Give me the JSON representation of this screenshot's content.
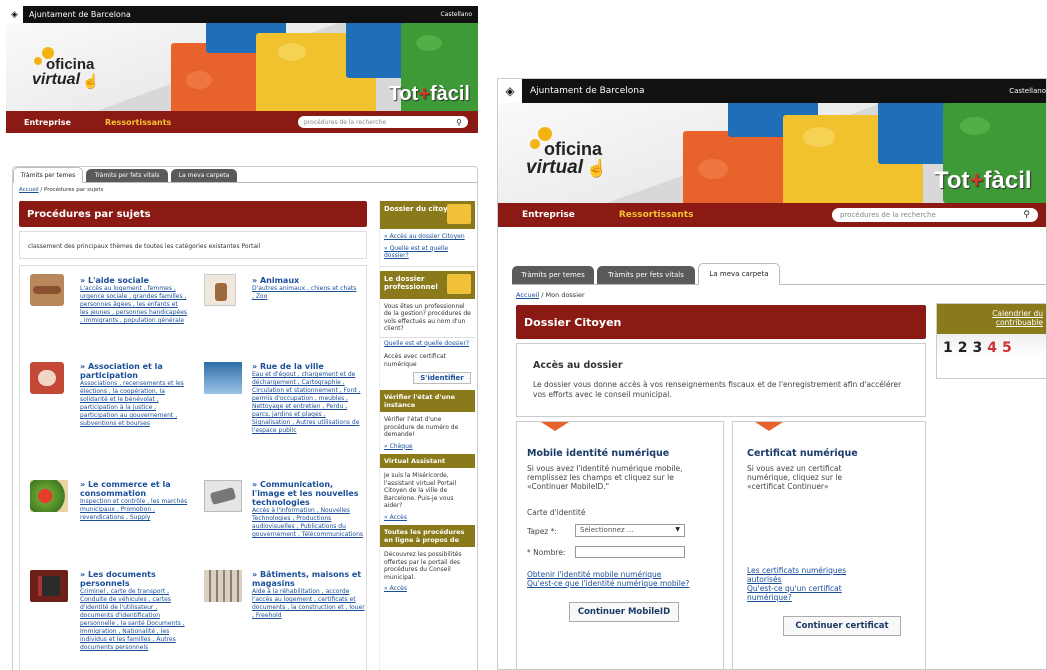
{
  "left": {
    "topbar": {
      "org": "Ajuntament de Barcelona",
      "lang": "Castellano"
    },
    "logo": {
      "line1": "oficina",
      "line2": "virtual"
    },
    "slogan": {
      "part1": "Tot",
      "plus": "+",
      "part2": "fàcil"
    },
    "nav": {
      "item1": "Entreprise",
      "item2": "Ressortissants",
      "search_placeholder": "procédures de la recherche"
    },
    "tabs": [
      "Tràmits per temes",
      "Tràmits per fets vitals",
      "La meva carpeta"
    ],
    "breadcrumb": {
      "home": "Accueil",
      "sep": " / ",
      "current": "Procédures par sujets"
    },
    "section_title": "Procédures par sujets",
    "intro": "classement des principaux thèmes de toutes les catégories existantes Portail",
    "categories": [
      {
        "title": "» L'aide sociale",
        "links": "L'accès au logement , femmes , urgence sociale , grandes familles , personnes âgées , les enfants et les jeunes , personnes handicapées , immigrants , population générale"
      },
      {
        "title": "» Animaux",
        "links": "D'autres animaux , chiens et chats , Zoo"
      },
      {
        "title": "» Association et la participation",
        "links": "Associations , recensements et les élections , la coopération, la solidarité et le bénévolat , participation à la justice , participation au gouvernement , subventions et bourses"
      },
      {
        "title": "» Rue de la ville",
        "links": "Eau et d'égout , chargement et de déchargement , Cartographie , Circulation et stationnement , Ford , permis d'occupation , meubles , Nettoyage et entretien , Perdu , parcs, jardins et plages , Signalisation , Autres utilisations de l'espace public"
      },
      {
        "title": "» Le commerce et la consommation",
        "links": "Inspection et contrôle , les marchés municipaux , Promotion , revendications , Supply"
      },
      {
        "title": "» Communication, l'image et les nouvelles technologies",
        "links": "Accès à l'information , Nouvelles Technologies , Productions audiovisuelles , Publications du gouvernement , Télécommunications"
      },
      {
        "title": "» Les documents personnels",
        "links": "Criminel , carte de transport , Conduite de véhicules , cartes d'identité de l'utilisateur , documents d'identification personnelle , la santé Documents , Immigration , Nationalité , les individus et les familles , Autres documents personnels"
      },
      {
        "title": "» Bâtiments, maisons et magasins",
        "links": "Aide à la réhabilitation , accorde l'accès au logement , certificats et documents , la construction et , louer , Freehold"
      }
    ],
    "sidebar": {
      "dossier_head": "Dossier du citoyen",
      "dossier_link1": "» Accès au dossier Citoyen",
      "dossier_link2": "» Quelle est et quelle dossier?",
      "pro_head": "Le dossier professionnel",
      "pro_text": "Vous êtes un professionnel de la gestion? procédures de vols effectués au nom d'un client?",
      "pro_link": "Quelle est et quelle dossier?",
      "pro_cert": "Accès avec certificat numérique",
      "identify_btn": "S'identifier",
      "verify_head": "Vérifier l'état d'une instance",
      "verify_text": "Vérifier l'état d'une procédure de numéro de demande!",
      "verify_link": "» Chèque",
      "va_head": "Virtual Assistant",
      "va_text": "Je suis la Miséricorde, l'assistant virtuel Portail Citoyen de la ville de Barcelone. Puis-je vous aider?",
      "va_link": "» Accès",
      "all_head": "Toutes les procédures en ligne à propos de",
      "all_text": "Découvrez les possibilités offertes par le portail des procédures du Conseil municipal.",
      "all_link": "» Accès"
    }
  },
  "right": {
    "topbar": {
      "org": "Ajuntament de Barcelona",
      "lang": "Castellano"
    },
    "logo": {
      "line1": "oficina",
      "line2": "virtual"
    },
    "slogan": {
      "part1": "Tot",
      "plus": "+",
      "part2": "fàcil"
    },
    "nav": {
      "item1": "Entreprise",
      "item2": "Ressortissants",
      "search_placeholder": "procédures de la recherche"
    },
    "tabs": [
      "Tràmits per temes",
      "Tràmits per fets vitals",
      "La meva carpeta"
    ],
    "breadcrumb": {
      "home": "Accueil",
      "sep": " / ",
      "current": "Mon dossier"
    },
    "section_title": "Dossier Citoyen",
    "access_title": "Accès au dossier",
    "access_text": "Le dossier vous donne accès à vos renseignements fiscaux et de l'enregistrement afin d'accélérer vos efforts avec le conseil municipal.",
    "mobile": {
      "title": "Mobile identité numérique",
      "text": "Si vous avez l'identité numérique mobile, remplissez les champs et cliquez sur le «Continuer MobileID.\"",
      "id_label": "Carte d'identité",
      "type_label": "Tapez *:",
      "type_value": "Sélectionnez ...",
      "number_label": "* Nombre:",
      "link1": "Obtenir l'identité mobile numérique",
      "link2": "Qu'est-ce que l'identité numérique mobile?",
      "button": "Continuer MobileID"
    },
    "cert": {
      "title": "Certificat numérique",
      "text": "Si vous avez un certificat numérique, cliquez sur le «certificat Continuer»",
      "link1": "Les certificats numériques autorisés",
      "link2": "Qu'est-ce qu'un certificat numérique?",
      "button": "Continuer certificat"
    },
    "calendar": {
      "title": "Calendrier du contribuable",
      "digits": [
        "1",
        "2",
        "3",
        "4",
        "5"
      ]
    }
  },
  "colors": {
    "brand_red": "#8a1a13",
    "sidebar_olive": "#8b7a1c",
    "link_blue": "#1a4f99",
    "accent_yellow": "#f6c233"
  }
}
